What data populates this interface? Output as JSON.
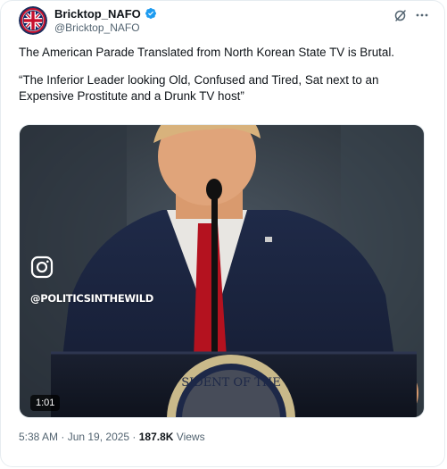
{
  "author": {
    "display_name": "Bricktop_NAFO",
    "handle": "@Bricktop_NAFO",
    "verified": true,
    "verified_color": "#1d9bf0",
    "avatar_icon": "union-jack-badge-icon"
  },
  "header_actions": {
    "grok_icon": "grok-icon",
    "more_icon": "more-options-icon"
  },
  "tweet": {
    "line1": "The American Parade Translated from North Korean State TV is Brutal.",
    "line2": "“The Inferior Leader looking Old, Confused and Tired, Sat next to an Expensive Prostitute and a Drunk TV host”"
  },
  "media": {
    "type": "video",
    "watermark_icon": "instagram-icon",
    "watermark_text": "@POLITICSINTHEWILD",
    "duration": "1:01"
  },
  "meta": {
    "timestamp": "5:38 AM · Jun 19, 2025 · ",
    "views_count": "187.8K",
    "views_label": " Views"
  },
  "colors": {
    "text_primary": "#0f1419",
    "text_secondary": "#536471",
    "border": "#e6ecf0"
  }
}
